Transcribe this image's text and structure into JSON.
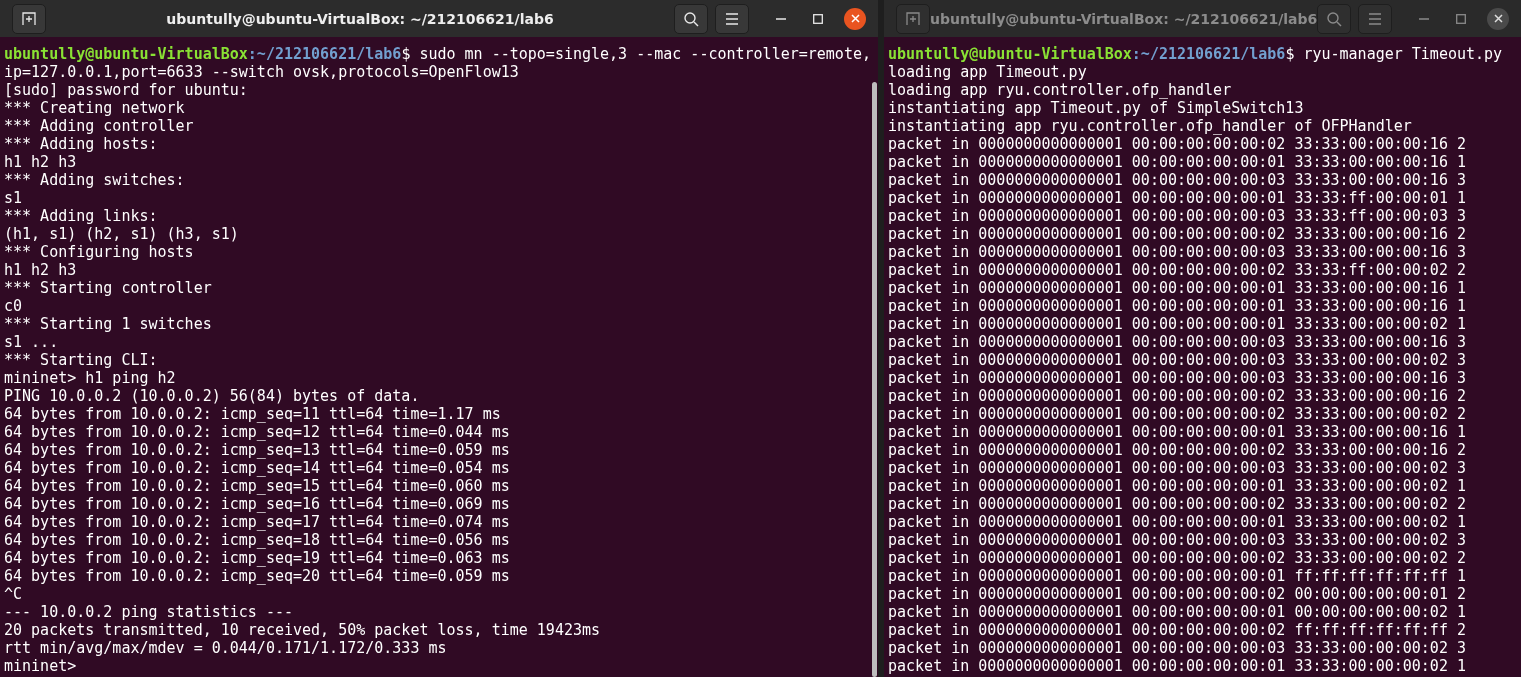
{
  "windows": [
    {
      "title": "ubuntully@ubuntu-VirtualBox: ~/212106621/lab6",
      "active": true,
      "lines": [
        {
          "kind": "prompt",
          "user": "ubuntully@ubuntu-VirtualBox",
          "path": ":~/212106621/lab6",
          "command": "$ sudo mn --topo=single,3 --mac --controller=remote,"
        },
        {
          "kind": "output",
          "text": "ip=127.0.0.1,port=6633 --switch ovsk,protocols=OpenFlow13"
        },
        {
          "kind": "output",
          "text": "[sudo] password for ubuntu:"
        },
        {
          "kind": "output",
          "text": "*** Creating network"
        },
        {
          "kind": "output",
          "text": "*** Adding controller"
        },
        {
          "kind": "output",
          "text": "*** Adding hosts:"
        },
        {
          "kind": "output",
          "text": "h1 h2 h3"
        },
        {
          "kind": "output",
          "text": "*** Adding switches:"
        },
        {
          "kind": "output",
          "text": "s1"
        },
        {
          "kind": "output",
          "text": "*** Adding links:"
        },
        {
          "kind": "output",
          "text": "(h1, s1) (h2, s1) (h3, s1)"
        },
        {
          "kind": "output",
          "text": "*** Configuring hosts"
        },
        {
          "kind": "output",
          "text": "h1 h2 h3"
        },
        {
          "kind": "output",
          "text": "*** Starting controller"
        },
        {
          "kind": "output",
          "text": "c0"
        },
        {
          "kind": "output",
          "text": "*** Starting 1 switches"
        },
        {
          "kind": "output",
          "text": "s1 ..."
        },
        {
          "kind": "output",
          "text": "*** Starting CLI:"
        },
        {
          "kind": "output",
          "text": "mininet> h1 ping h2"
        },
        {
          "kind": "output",
          "text": "PING 10.0.0.2 (10.0.0.2) 56(84) bytes of data."
        },
        {
          "kind": "output",
          "text": "64 bytes from 10.0.0.2: icmp_seq=11 ttl=64 time=1.17 ms"
        },
        {
          "kind": "output",
          "text": "64 bytes from 10.0.0.2: icmp_seq=12 ttl=64 time=0.044 ms"
        },
        {
          "kind": "output",
          "text": "64 bytes from 10.0.0.2: icmp_seq=13 ttl=64 time=0.059 ms"
        },
        {
          "kind": "output",
          "text": "64 bytes from 10.0.0.2: icmp_seq=14 ttl=64 time=0.054 ms"
        },
        {
          "kind": "output",
          "text": "64 bytes from 10.0.0.2: icmp_seq=15 ttl=64 time=0.060 ms"
        },
        {
          "kind": "output",
          "text": "64 bytes from 10.0.0.2: icmp_seq=16 ttl=64 time=0.069 ms"
        },
        {
          "kind": "output",
          "text": "64 bytes from 10.0.0.2: icmp_seq=17 ttl=64 time=0.074 ms"
        },
        {
          "kind": "output",
          "text": "64 bytes from 10.0.0.2: icmp_seq=18 ttl=64 time=0.056 ms"
        },
        {
          "kind": "output",
          "text": "64 bytes from 10.0.0.2: icmp_seq=19 ttl=64 time=0.063 ms"
        },
        {
          "kind": "output",
          "text": "64 bytes from 10.0.0.2: icmp_seq=20 ttl=64 time=0.059 ms"
        },
        {
          "kind": "output",
          "text": "^C"
        },
        {
          "kind": "output",
          "text": "--- 10.0.0.2 ping statistics ---"
        },
        {
          "kind": "output",
          "text": "20 packets transmitted, 10 received, 50% packet loss, time 19423ms"
        },
        {
          "kind": "output",
          "text": "rtt min/avg/max/mdev = 0.044/0.171/1.172/0.333 ms"
        },
        {
          "kind": "output",
          "text": "mininet>"
        }
      ]
    },
    {
      "title": "ubuntully@ubuntu-VirtualBox: ~/212106621/lab6",
      "active": false,
      "lines": [
        {
          "kind": "prompt",
          "user": "ubuntully@ubuntu-VirtualBox",
          "path": ":~/212106621/lab6",
          "command": "$ ryu-manager Timeout.py"
        },
        {
          "kind": "output",
          "text": "loading app Timeout.py"
        },
        {
          "kind": "output",
          "text": "loading app ryu.controller.ofp_handler"
        },
        {
          "kind": "output",
          "text": "instantiating app Timeout.py of SimpleSwitch13"
        },
        {
          "kind": "output",
          "text": "instantiating app ryu.controller.ofp_handler of OFPHandler"
        },
        {
          "kind": "output",
          "text": "packet in 0000000000000001 00:00:00:00:00:02 33:33:00:00:00:16 2"
        },
        {
          "kind": "output",
          "text": "packet in 0000000000000001 00:00:00:00:00:01 33:33:00:00:00:16 1"
        },
        {
          "kind": "output",
          "text": "packet in 0000000000000001 00:00:00:00:00:03 33:33:00:00:00:16 3"
        },
        {
          "kind": "output",
          "text": "packet in 0000000000000001 00:00:00:00:00:01 33:33:ff:00:00:01 1"
        },
        {
          "kind": "output",
          "text": "packet in 0000000000000001 00:00:00:00:00:03 33:33:ff:00:00:03 3"
        },
        {
          "kind": "output",
          "text": "packet in 0000000000000001 00:00:00:00:00:02 33:33:00:00:00:16 2"
        },
        {
          "kind": "output",
          "text": "packet in 0000000000000001 00:00:00:00:00:03 33:33:00:00:00:16 3"
        },
        {
          "kind": "output",
          "text": "packet in 0000000000000001 00:00:00:00:00:02 33:33:ff:00:00:02 2"
        },
        {
          "kind": "output",
          "text": "packet in 0000000000000001 00:00:00:00:00:01 33:33:00:00:00:16 1"
        },
        {
          "kind": "output",
          "text": "packet in 0000000000000001 00:00:00:00:00:01 33:33:00:00:00:16 1"
        },
        {
          "kind": "output",
          "text": "packet in 0000000000000001 00:00:00:00:00:01 33:33:00:00:00:02 1"
        },
        {
          "kind": "output",
          "text": "packet in 0000000000000001 00:00:00:00:00:03 33:33:00:00:00:16 3"
        },
        {
          "kind": "output",
          "text": "packet in 0000000000000001 00:00:00:00:00:03 33:33:00:00:00:02 3"
        },
        {
          "kind": "output",
          "text": "packet in 0000000000000001 00:00:00:00:00:03 33:33:00:00:00:16 3"
        },
        {
          "kind": "output",
          "text": "packet in 0000000000000001 00:00:00:00:00:02 33:33:00:00:00:16 2"
        },
        {
          "kind": "output",
          "text": "packet in 0000000000000001 00:00:00:00:00:02 33:33:00:00:00:02 2"
        },
        {
          "kind": "output",
          "text": "packet in 0000000000000001 00:00:00:00:00:01 33:33:00:00:00:16 1"
        },
        {
          "kind": "output",
          "text": "packet in 0000000000000001 00:00:00:00:00:02 33:33:00:00:00:16 2"
        },
        {
          "kind": "output",
          "text": "packet in 0000000000000001 00:00:00:00:00:03 33:33:00:00:00:02 3"
        },
        {
          "kind": "output",
          "text": "packet in 0000000000000001 00:00:00:00:00:01 33:33:00:00:00:02 1"
        },
        {
          "kind": "output",
          "text": "packet in 0000000000000001 00:00:00:00:00:02 33:33:00:00:00:02 2"
        },
        {
          "kind": "output",
          "text": "packet in 0000000000000001 00:00:00:00:00:01 33:33:00:00:00:02 1"
        },
        {
          "kind": "output",
          "text": "packet in 0000000000000001 00:00:00:00:00:03 33:33:00:00:00:02 3"
        },
        {
          "kind": "output",
          "text": "packet in 0000000000000001 00:00:00:00:00:02 33:33:00:00:00:02 2"
        },
        {
          "kind": "output",
          "text": "packet in 0000000000000001 00:00:00:00:00:01 ff:ff:ff:ff:ff:ff 1"
        },
        {
          "kind": "output",
          "text": "packet in 0000000000000001 00:00:00:00:00:02 00:00:00:00:00:01 2"
        },
        {
          "kind": "output",
          "text": "packet in 0000000000000001 00:00:00:00:00:01 00:00:00:00:00:02 1"
        },
        {
          "kind": "output",
          "text": "packet in 0000000000000001 00:00:00:00:00:02 ff:ff:ff:ff:ff:ff 2"
        },
        {
          "kind": "output",
          "text": "packet in 0000000000000001 00:00:00:00:00:03 33:33:00:00:00:02 3"
        },
        {
          "kind": "output",
          "text": "packet in 0000000000000001 00:00:00:00:00:01 33:33:00:00:00:02 1"
        }
      ]
    }
  ]
}
